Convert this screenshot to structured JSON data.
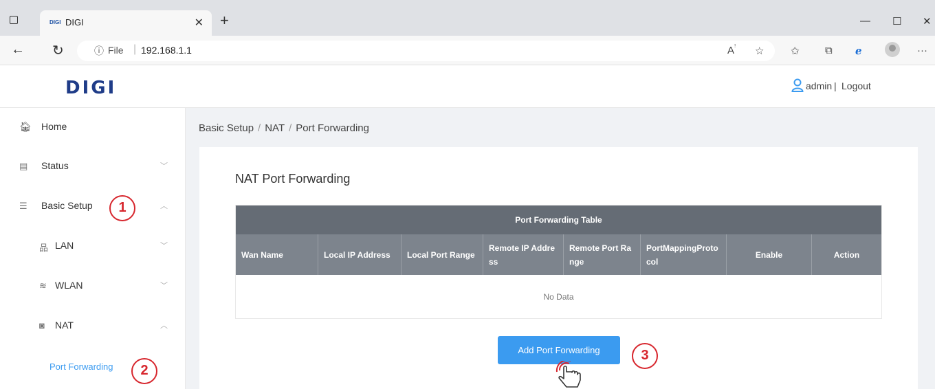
{
  "browser": {
    "tab_title": "DIGI",
    "tab_favicon_text": "DIGI",
    "url_prefix": "File",
    "url": "192.168.1.1"
  },
  "header": {
    "logo_text": "DIGI",
    "user": "admin",
    "separator": "|",
    "logout": "Logout"
  },
  "sidebar": {
    "items": [
      {
        "label": "Home"
      },
      {
        "label": "Status"
      },
      {
        "label": "Basic Setup"
      },
      {
        "label": "LAN"
      },
      {
        "label": "WLAN"
      },
      {
        "label": "NAT"
      },
      {
        "label": "Port Forwarding"
      }
    ]
  },
  "breadcrumb": [
    "Basic Setup",
    "NAT",
    "Port Forwarding"
  ],
  "main": {
    "title": "NAT Port Forwarding",
    "table": {
      "caption": "Port Forwarding Table",
      "columns": [
        "Wan Name",
        "Local IP Address",
        "Local Port Range",
        "Remote IP Address",
        "Remote Port Range",
        "PortMappingProtocol",
        "Enable",
        "Action"
      ],
      "empty_text": "No Data"
    },
    "add_button": "Add Port Forwarding"
  },
  "annotations": [
    "1",
    "2",
    "3"
  ],
  "colors": {
    "accent": "#3b9bf0",
    "badge": "#d7262d",
    "table_caption": "#656c75",
    "table_header": "#7d848d"
  }
}
